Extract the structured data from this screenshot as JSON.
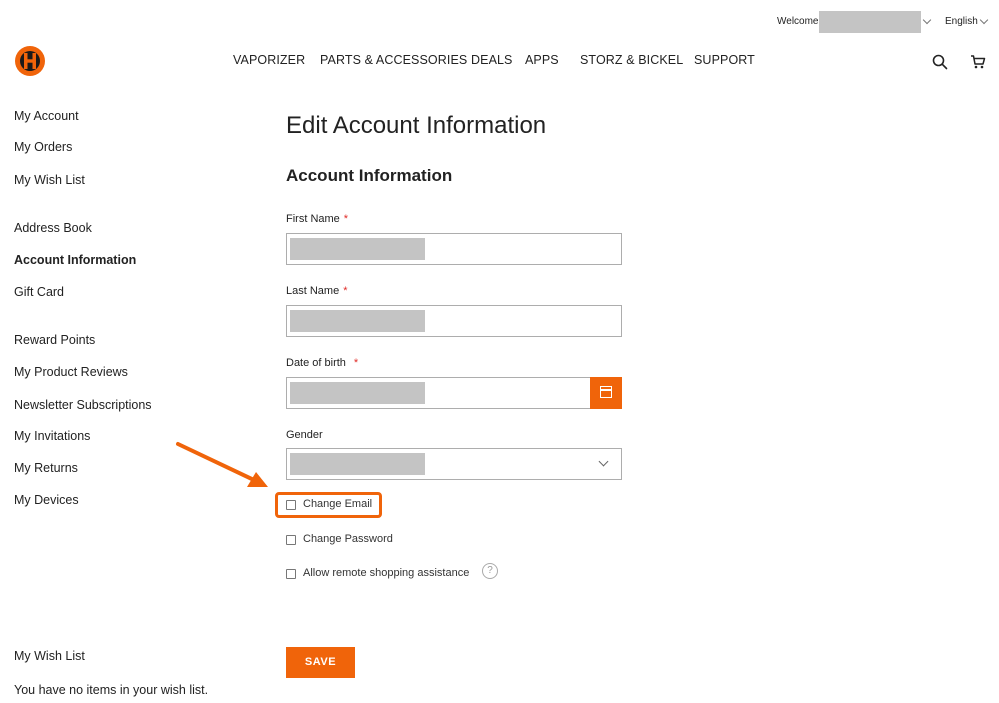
{
  "topbar": {
    "welcome": "Welcome,",
    "language": "English"
  },
  "nav": {
    "items": [
      "VAPORIZER",
      "PARTS & ACCESSORIES",
      "DEALS",
      "APPS",
      "STORZ & BICKEL",
      "SUPPORT"
    ]
  },
  "sidebar": {
    "items": [
      {
        "label": "My Account"
      },
      {
        "label": "My Orders"
      },
      {
        "label": "My Wish List"
      },
      {
        "label": "Address Book"
      },
      {
        "label": "Account Information"
      },
      {
        "label": "Gift Card"
      },
      {
        "label": "Reward Points"
      },
      {
        "label": "My Product Reviews"
      },
      {
        "label": "Newsletter Subscriptions"
      },
      {
        "label": "My Invitations"
      },
      {
        "label": "My Returns"
      },
      {
        "label": "My Devices"
      }
    ],
    "wishlist_title": "My Wish List",
    "wishlist_empty": "You have no items in your wish list."
  },
  "main": {
    "page_title": "Edit Account Information",
    "section_title": "Account Information",
    "fields": {
      "first_name": "First Name",
      "last_name": "Last Name",
      "dob": "Date of birth",
      "gender": "Gender",
      "required_mark": "*"
    },
    "options": {
      "change_email": "Change Email",
      "change_password": "Change Password",
      "remote_assistance": "Allow remote shopping assistance"
    },
    "help": "?",
    "save": "SAVE"
  },
  "colors": {
    "accent": "#f0640a",
    "redaction": "#c4c4c4",
    "required": "#e02b27"
  },
  "icons": [
    "logo-icon",
    "search-icon",
    "cart-icon",
    "calendar-icon",
    "chevron-down-icon",
    "help-icon",
    "arrow-icon"
  ]
}
